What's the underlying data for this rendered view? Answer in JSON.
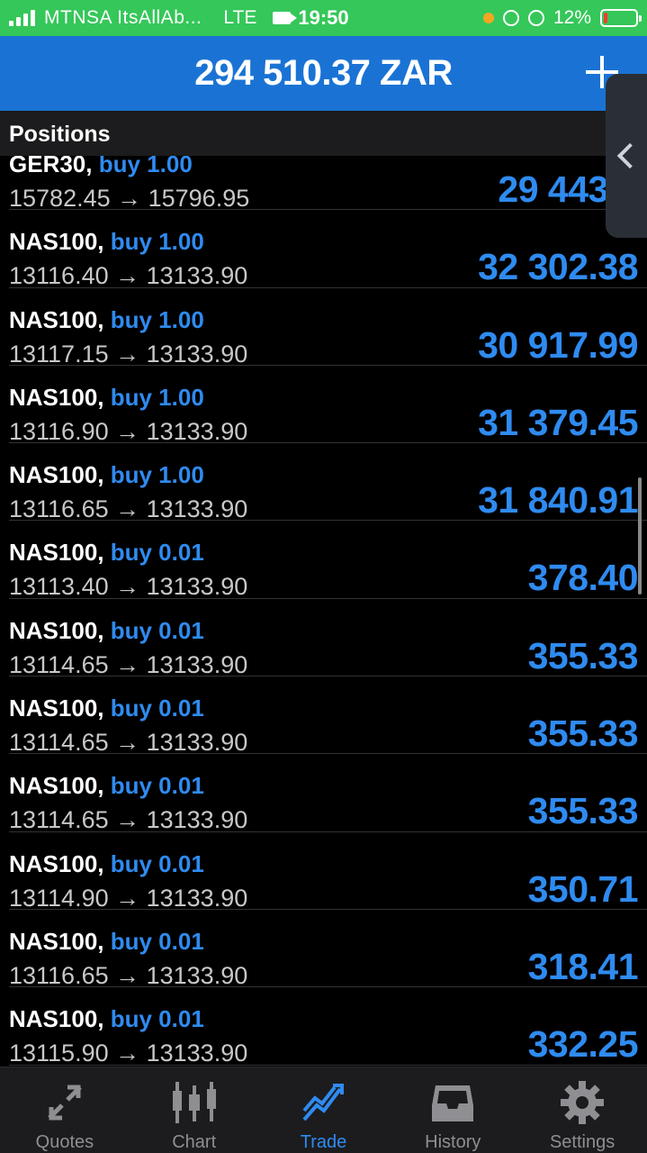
{
  "status_bar": {
    "carrier": "MTNSA ItsAllAb...",
    "network": "LTE",
    "time": "19:50",
    "battery": "12%",
    "battery_level": 0.12,
    "colors": {
      "background": "#35c759",
      "battery_low": "#ff3b30",
      "dot": "#f5a623"
    }
  },
  "header": {
    "balance": "294 510.37 ZAR",
    "add_icon": "plus-icon",
    "color": "#1a73d4"
  },
  "section": {
    "title": "Positions"
  },
  "side_tab": {
    "icon": "chevron-left-icon"
  },
  "positions": [
    {
      "symbol": "GER30,",
      "side": "buy 1.00",
      "prices": "15782.45 → 15796.95",
      "profit": "29 443.5"
    },
    {
      "symbol": "NAS100,",
      "side": "buy 1.00",
      "prices": "13116.40 → 13133.90",
      "profit": "32 302.38"
    },
    {
      "symbol": "NAS100,",
      "side": "buy 1.00",
      "prices": "13117.15 → 13133.90",
      "profit": "30 917.99"
    },
    {
      "symbol": "NAS100,",
      "side": "buy 1.00",
      "prices": "13116.90 → 13133.90",
      "profit": "31 379.45"
    },
    {
      "symbol": "NAS100,",
      "side": "buy 1.00",
      "prices": "13116.65 → 13133.90",
      "profit": "31 840.91"
    },
    {
      "symbol": "NAS100,",
      "side": "buy 0.01",
      "prices": "13113.40 → 13133.90",
      "profit": "378.40"
    },
    {
      "symbol": "NAS100,",
      "side": "buy 0.01",
      "prices": "13114.65 → 13133.90",
      "profit": "355.33"
    },
    {
      "symbol": "NAS100,",
      "side": "buy 0.01",
      "prices": "13114.65 → 13133.90",
      "profit": "355.33"
    },
    {
      "symbol": "NAS100,",
      "side": "buy 0.01",
      "prices": "13114.65 → 13133.90",
      "profit": "355.33"
    },
    {
      "symbol": "NAS100,",
      "side": "buy 0.01",
      "prices": "13114.90 → 13133.90",
      "profit": "350.71"
    },
    {
      "symbol": "NAS100,",
      "side": "buy 0.01",
      "prices": "13116.65 → 13133.90",
      "profit": "318.41"
    },
    {
      "symbol": "NAS100,",
      "side": "buy 0.01",
      "prices": "13115.90 → 13133.90",
      "profit": "332.25"
    }
  ],
  "tabs": [
    {
      "label": "Quotes",
      "icon": "quotes-icon",
      "active": false
    },
    {
      "label": "Chart",
      "icon": "candlestick-chart-icon",
      "active": false
    },
    {
      "label": "Trade",
      "icon": "trade-trend-icon",
      "active": true
    },
    {
      "label": "History",
      "icon": "history-inbox-icon",
      "active": false
    },
    {
      "label": "Settings",
      "icon": "gear-icon",
      "active": false
    }
  ],
  "colors": {
    "accent": "#2f8bf0",
    "price_text": "#c8c8c8"
  }
}
